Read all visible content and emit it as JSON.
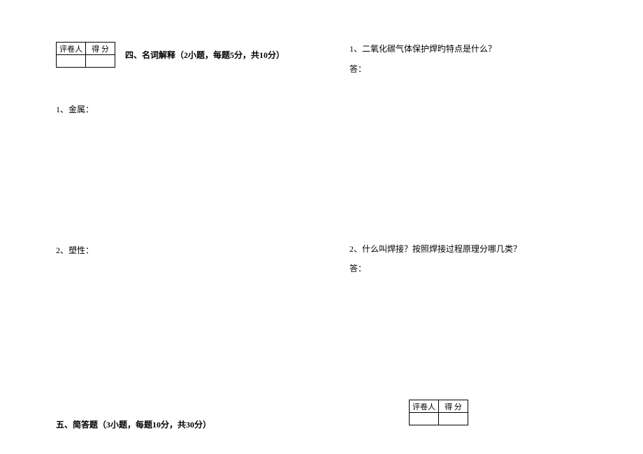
{
  "scoringTable": {
    "col1": "评卷人",
    "col2": "得 分"
  },
  "leftColumn": {
    "section4": {
      "title": "四、名词解释（2小题，每题5分，共10分）"
    },
    "q1": "1、金属：",
    "q2": "2、塑性：",
    "section5": {
      "title": "五、简答题（3小题，每题10分，共30分）"
    }
  },
  "rightColumn": {
    "q1": "1、二氧化碳气体保护焊旳特点是什么？",
    "q1_answer": "答：",
    "q2": "2、什么叫焊接？按照焊接过程原理分哪几类？",
    "q2_answer": "答："
  }
}
